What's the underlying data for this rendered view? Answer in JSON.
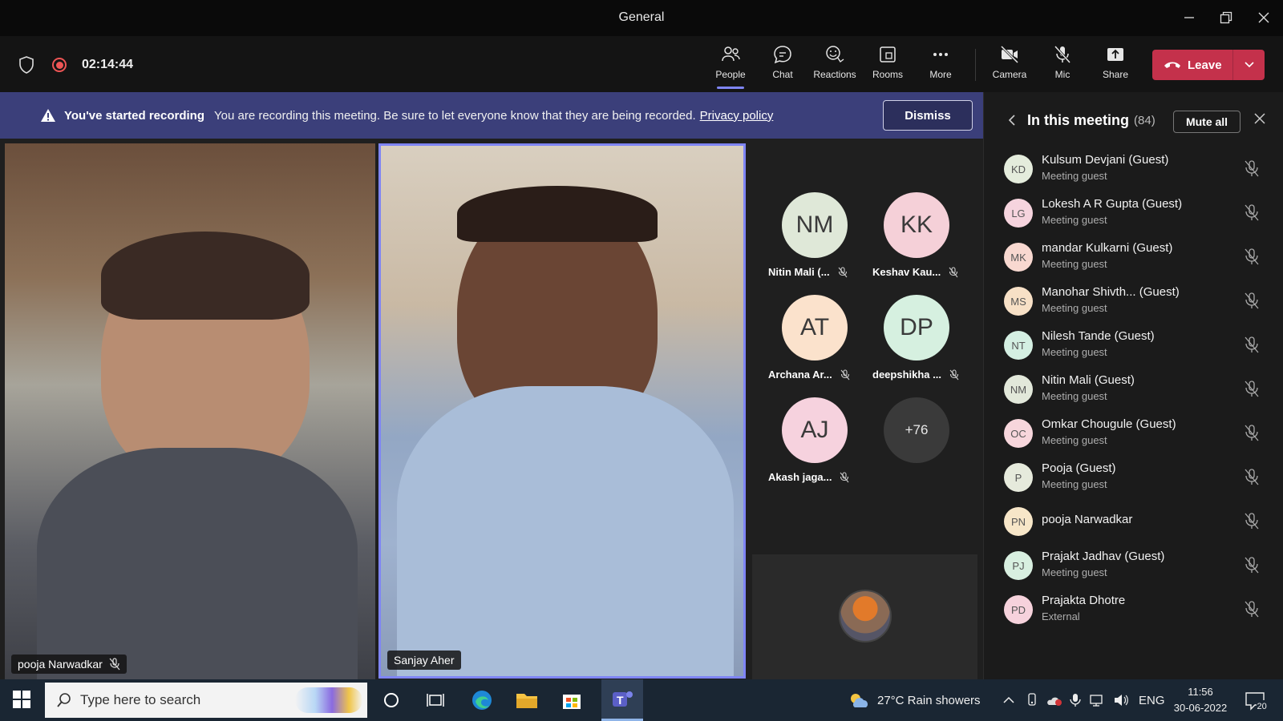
{
  "window": {
    "title": "General"
  },
  "meeting": {
    "timer": "02:14:44"
  },
  "toolbar": {
    "people": "People",
    "chat": "Chat",
    "reactions": "Reactions",
    "rooms": "Rooms",
    "more": "More",
    "camera": "Camera",
    "mic": "Mic",
    "share": "Share",
    "leave": "Leave"
  },
  "banner": {
    "title": "You've started recording",
    "message": "You are recording this meeting. Be sure to let everyone know that they are being recorded.",
    "link": "Privacy policy",
    "dismiss": "Dismiss"
  },
  "videos": {
    "left": {
      "name": "pooja Narwadkar",
      "muted": true
    },
    "center": {
      "name": "Sanjay Aher",
      "muted": false
    }
  },
  "avatars": [
    {
      "initials": "NM",
      "name": "Nitin Mali (...",
      "color": "#dfe8d8"
    },
    {
      "initials": "KK",
      "name": "Keshav Kau...",
      "color": "#f5d0d8"
    },
    {
      "initials": "AT",
      "name": "Archana Ar...",
      "color": "#fbe2cc"
    },
    {
      "initials": "DP",
      "name": "deepshikha ...",
      "color": "#d6f0e0"
    },
    {
      "initials": "AJ",
      "name": "Akash jaga...",
      "color": "#f6d2de"
    }
  ],
  "overflow": "+76",
  "panel": {
    "title": "In this meeting",
    "count": "(84)",
    "mute_all": "Mute all",
    "participants": [
      {
        "initials": "KD",
        "name": "Kulsum Devjani (Guest)",
        "role": "Meeting guest",
        "color": "#e4ecdc"
      },
      {
        "initials": "LG",
        "name": "Lokesh A R Gupta (Guest)",
        "role": "Meeting guest",
        "color": "#f6d4de"
      },
      {
        "initials": "MK",
        "name": "mandar Kulkarni (Guest)",
        "role": "Meeting guest",
        "color": "#f8d8d0"
      },
      {
        "initials": "MS",
        "name": "Manohar Shivth...  (Guest)",
        "role": "Meeting guest",
        "color": "#f7e0c6"
      },
      {
        "initials": "NT",
        "name": "Nilesh Tande (Guest)",
        "role": "Meeting guest",
        "color": "#d4efe2"
      },
      {
        "initials": "NM",
        "name": "Nitin Mali (Guest)",
        "role": "Meeting guest",
        "color": "#e2e8da"
      },
      {
        "initials": "OC",
        "name": "Omkar Chougule (Guest)",
        "role": "Meeting guest",
        "color": "#f7d6dc"
      },
      {
        "initials": "P",
        "name": "Pooja (Guest)",
        "role": "Meeting guest",
        "color": "#e6eadc"
      },
      {
        "initials": "PN",
        "name": "pooja Narwadkar",
        "role": "",
        "color": "#f7e6c8"
      },
      {
        "initials": "PJ",
        "name": "Prajakt Jadhav (Guest)",
        "role": "Meeting guest",
        "color": "#d8efe0"
      },
      {
        "initials": "PD",
        "name": "Prajakta Dhotre",
        "role": "External",
        "color": "#f6d2dc"
      }
    ]
  },
  "taskbar": {
    "search_placeholder": "Type here to search",
    "weather": "27°C  Rain showers",
    "lang": "ENG",
    "time": "11:56",
    "date": "30-06-2022",
    "notifications": "20"
  }
}
